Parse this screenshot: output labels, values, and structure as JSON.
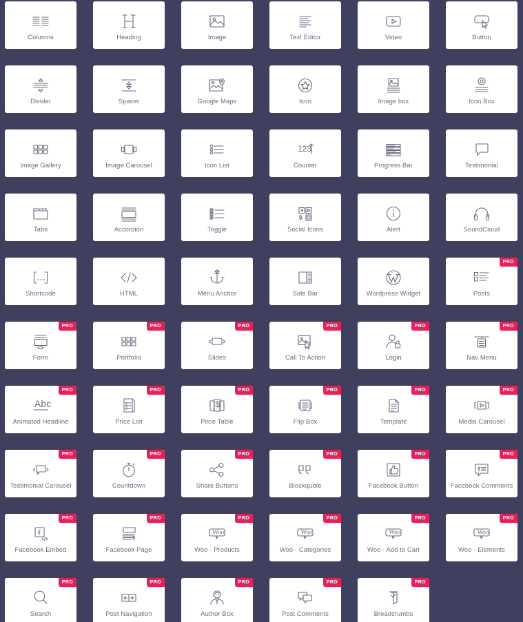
{
  "panel": {
    "background_color": "#3f3f5f",
    "card_color": "#ffffff",
    "label_color": "#6a6a80",
    "pro_badge_color": "#e8205a",
    "pro_badge_label": "PRO"
  },
  "widgets": [
    {
      "label": "Columns",
      "icon": "columns-icon",
      "pro": false
    },
    {
      "label": "Heading",
      "icon": "heading-icon",
      "pro": false
    },
    {
      "label": "Image",
      "icon": "image-icon",
      "pro": false
    },
    {
      "label": "Text Editor",
      "icon": "text-editor-icon",
      "pro": false
    },
    {
      "label": "Video",
      "icon": "video-icon",
      "pro": false
    },
    {
      "label": "Button",
      "icon": "button-icon",
      "pro": false
    },
    {
      "label": "Divider",
      "icon": "divider-icon",
      "pro": false
    },
    {
      "label": "Spacer",
      "icon": "spacer-icon",
      "pro": false
    },
    {
      "label": "Google Maps",
      "icon": "google-maps-icon",
      "pro": false
    },
    {
      "label": "Icon",
      "icon": "star-icon",
      "pro": false
    },
    {
      "label": "Image box",
      "icon": "image-box-icon",
      "pro": false
    },
    {
      "label": "Icon Box",
      "icon": "icon-box-icon",
      "pro": false
    },
    {
      "label": "Image Gallery",
      "icon": "image-gallery-icon",
      "pro": false
    },
    {
      "label": "Image Carousel",
      "icon": "image-carousel-icon",
      "pro": false
    },
    {
      "label": "Icon List",
      "icon": "icon-list-icon",
      "pro": false
    },
    {
      "label": "Counter",
      "icon": "counter-icon",
      "pro": false
    },
    {
      "label": "Progress Bar",
      "icon": "progress-bar-icon",
      "pro": false
    },
    {
      "label": "Testimonial",
      "icon": "testimonial-icon",
      "pro": false
    },
    {
      "label": "Tabs",
      "icon": "tabs-icon",
      "pro": false
    },
    {
      "label": "Accordion",
      "icon": "accordion-icon",
      "pro": false
    },
    {
      "label": "Toggle",
      "icon": "toggle-icon",
      "pro": false
    },
    {
      "label": "Social Icons",
      "icon": "social-icons-icon",
      "pro": false
    },
    {
      "label": "Alert",
      "icon": "alert-info-icon",
      "pro": false
    },
    {
      "label": "SoundCloud",
      "icon": "soundcloud-headphones-icon",
      "pro": false
    },
    {
      "label": "Shortcode",
      "icon": "shortcode-icon",
      "pro": false
    },
    {
      "label": "HTML",
      "icon": "html-code-icon",
      "pro": false
    },
    {
      "label": "Menu Anchor",
      "icon": "anchor-icon",
      "pro": false
    },
    {
      "label": "Side Bar",
      "icon": "sidebar-icon",
      "pro": false
    },
    {
      "label": "Wordpress Widget",
      "icon": "wordpress-icon",
      "pro": false
    },
    {
      "label": "Posts",
      "icon": "posts-icon",
      "pro": true
    },
    {
      "label": "Form",
      "icon": "form-icon",
      "pro": true
    },
    {
      "label": "Portfolio",
      "icon": "portfolio-icon",
      "pro": true
    },
    {
      "label": "Slides",
      "icon": "slides-icon",
      "pro": true
    },
    {
      "label": "Call To Action",
      "icon": "call-to-action-icon",
      "pro": true
    },
    {
      "label": "Login",
      "icon": "login-icon",
      "pro": true
    },
    {
      "label": "Nav Menu",
      "icon": "nav-menu-icon",
      "pro": true
    },
    {
      "label": "Animated Headline",
      "icon": "animated-headline-icon",
      "pro": true
    },
    {
      "label": "Price List",
      "icon": "price-list-icon",
      "pro": true
    },
    {
      "label": "Price Table",
      "icon": "price-table-icon",
      "pro": true
    },
    {
      "label": "Flip Box",
      "icon": "flip-box-icon",
      "pro": true
    },
    {
      "label": "Template",
      "icon": "template-icon",
      "pro": true
    },
    {
      "label": "Media Carousel",
      "icon": "media-carousel-icon",
      "pro": true
    },
    {
      "label": "Testimonial Carousel",
      "icon": "testimonial-carousel-icon",
      "pro": true
    },
    {
      "label": "Countdown",
      "icon": "countdown-stopwatch-icon",
      "pro": true
    },
    {
      "label": "Share Buttons",
      "icon": "share-icon",
      "pro": true
    },
    {
      "label": "Blockquote",
      "icon": "blockquote-icon",
      "pro": true
    },
    {
      "label": "Facebook Button",
      "icon": "facebook-thumbs-up-icon",
      "pro": true
    },
    {
      "label": "Facebook Comments",
      "icon": "facebook-comments-icon",
      "pro": true
    },
    {
      "label": "Facebook Embed",
      "icon": "facebook-embed-icon",
      "pro": true
    },
    {
      "label": "Facebook Page",
      "icon": "facebook-page-icon",
      "pro": true
    },
    {
      "label": "Woo - Products",
      "icon": "woo-icon",
      "pro": true
    },
    {
      "label": "Woo - Categories",
      "icon": "woo-icon",
      "pro": true
    },
    {
      "label": "Woo - Add to Cart",
      "icon": "woo-icon",
      "pro": true
    },
    {
      "label": "Woo - Elements",
      "icon": "woo-icon",
      "pro": true
    },
    {
      "label": "Search",
      "icon": "search-icon",
      "pro": true
    },
    {
      "label": "Post Navigation",
      "icon": "post-navigation-icon",
      "pro": true
    },
    {
      "label": "Author Box",
      "icon": "author-box-icon",
      "pro": true
    },
    {
      "label": "Post Comments",
      "icon": "post-comments-icon",
      "pro": true
    },
    {
      "label": "Breadcrumbs",
      "icon": "breadcrumbs-icon",
      "pro": true
    }
  ]
}
